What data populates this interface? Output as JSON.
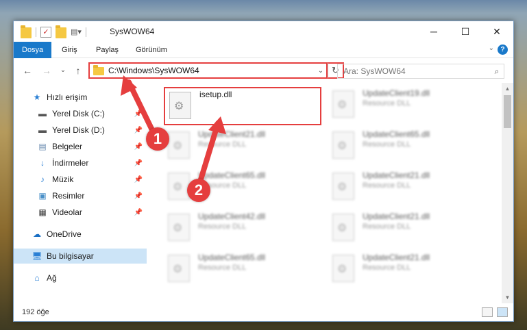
{
  "window": {
    "title": "SysWOW64",
    "minimize": "─",
    "maximize": "☐",
    "close": "✕"
  },
  "ribbon": {
    "tabs": [
      "Dosya",
      "Giriş",
      "Paylaş",
      "Görünüm"
    ],
    "active_tab": "Dosya",
    "help": "?"
  },
  "nav": {
    "back": "←",
    "forward": "→",
    "recent": "⌄",
    "up": "↑",
    "address": "C:\\Windows\\SysWOW64",
    "search_placeholder": "Ara: SysWOW64",
    "refresh": "↻"
  },
  "sidebar": {
    "items": [
      {
        "label": "Hızlı erişim",
        "icon": "star-icon",
        "pinned": false
      },
      {
        "label": "Yerel Disk (C:)",
        "icon": "drive-icon",
        "pinned": true
      },
      {
        "label": "Yerel Disk (D:)",
        "icon": "drive-icon",
        "pinned": true
      },
      {
        "label": "Belgeler",
        "icon": "documents-icon",
        "pinned": true
      },
      {
        "label": "İndirmeler",
        "icon": "download-icon",
        "pinned": true
      },
      {
        "label": "Müzik",
        "icon": "music-icon",
        "pinned": true
      },
      {
        "label": "Resimler",
        "icon": "pictures-icon",
        "pinned": true
      },
      {
        "label": "Videolar",
        "icon": "video-icon",
        "pinned": true
      },
      {
        "label": "OneDrive",
        "icon": "cloud-icon",
        "pinned": false
      },
      {
        "label": "Bu bilgisayar",
        "icon": "computer-icon",
        "pinned": false
      },
      {
        "label": "Ağ",
        "icon": "network-icon",
        "pinned": false
      }
    ],
    "selected": "Bu bilgisayar"
  },
  "files": [
    {
      "name": "isetup.dll",
      "type": "",
      "highlighted": true
    },
    {
      "name": "UpdateClient19.dll",
      "type": "Resource DLL"
    },
    {
      "name": "UpdateClient21.dll",
      "type": "Resource DLL"
    },
    {
      "name": "UpdateClient65.dll",
      "type": "Resource DLL"
    },
    {
      "name": "UpdateClient65.dll",
      "type": "Resource DLL"
    },
    {
      "name": "UpdateClient21.dll",
      "type": "Resource DLL"
    },
    {
      "name": "UpdateClient42.dll",
      "type": "Resource DLL"
    },
    {
      "name": "UpdateClient21.dll",
      "type": "Resource DLL"
    },
    {
      "name": "UpdateClient65.dll",
      "type": "Resource DLL"
    },
    {
      "name": "UpdateClient21.dll",
      "type": "Resource DLL"
    }
  ],
  "status": {
    "item_count": "192 öğe"
  },
  "annotations": {
    "step1": "1",
    "step2": "2",
    "color": "#e53e3e"
  }
}
